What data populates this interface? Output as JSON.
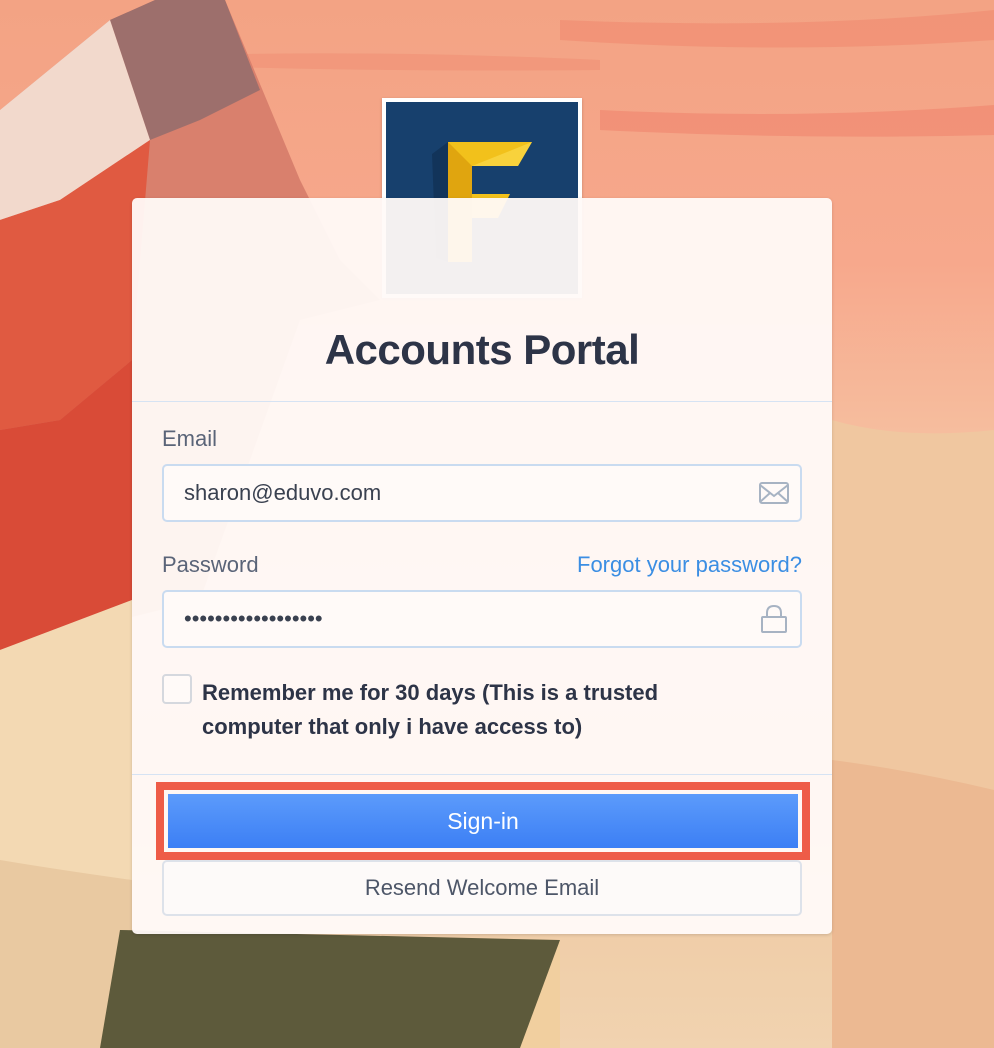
{
  "brand": {
    "logo_letter": "F",
    "logo_bg": "#17406d",
    "logo_accent": "#f2c11b"
  },
  "portal": {
    "title": "Accounts Portal"
  },
  "email": {
    "label": "Email",
    "value": "sharon@eduvo.com",
    "icon": "envelope-icon"
  },
  "password": {
    "label": "Password",
    "forgot_link": "Forgot your password?",
    "value": "••••••••••••••••••",
    "icon": "lock-icon"
  },
  "remember": {
    "checked": false,
    "label": "Remember me for 30 days (This is a trusted computer that only i have access to)"
  },
  "actions": {
    "signin_label": "Sign-in",
    "resend_label": "Resend Welcome Email"
  },
  "colors": {
    "primary": "#4a8cf8",
    "link": "#3b8ee3",
    "highlight": "#ee5c47"
  }
}
